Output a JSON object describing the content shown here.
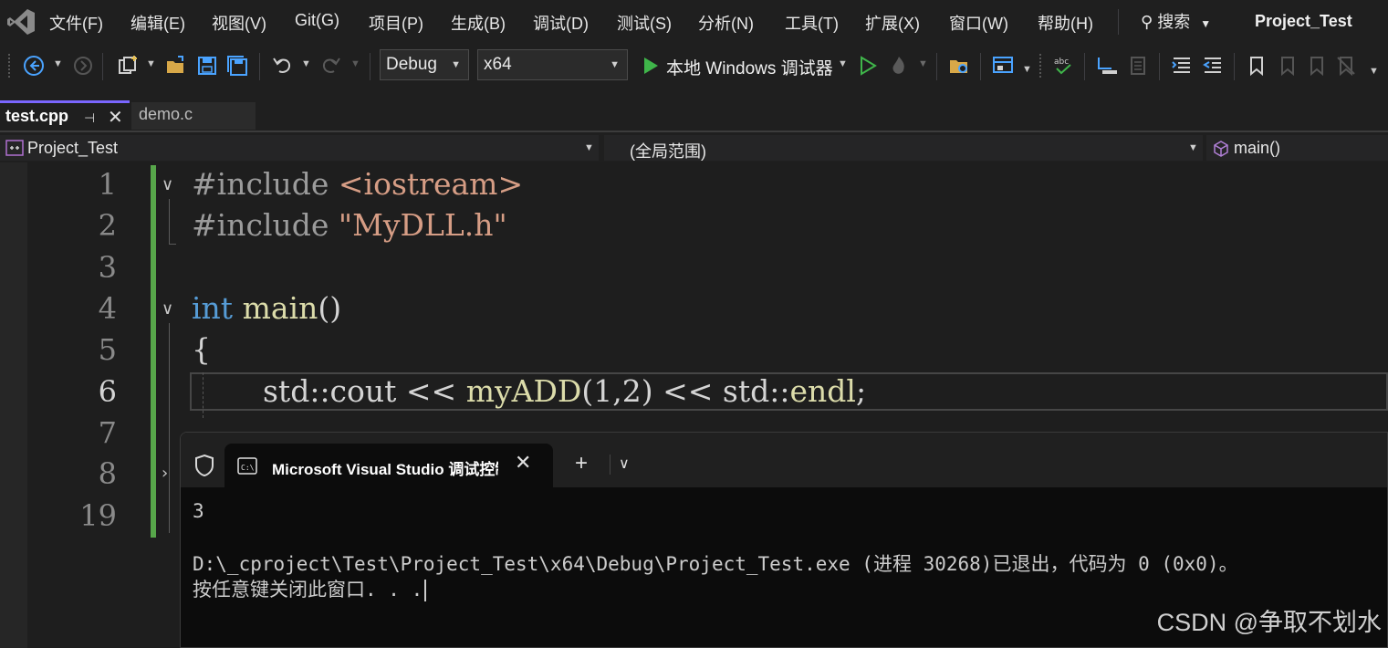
{
  "menubar": {
    "items": [
      "文件(F)",
      "编辑(E)",
      "视图(V)",
      "Git(G)",
      "项目(P)",
      "生成(B)",
      "调试(D)",
      "测试(S)",
      "分析(N)",
      "工具(T)",
      "扩展(X)",
      "窗口(W)",
      "帮助(H)"
    ],
    "search_label": "搜索",
    "project_title": "Project_Test"
  },
  "toolbar": {
    "config": "Debug",
    "platform": "x64",
    "run_label": "本地 Windows 调试器"
  },
  "tabs": {
    "active": "test.cpp",
    "other": "demo.c"
  },
  "navbar": {
    "project": "Project_Test",
    "scope": "(全局范围)",
    "member": "main()"
  },
  "editor": {
    "line_numbers": [
      "1",
      "2",
      "3",
      "4",
      "5",
      "6",
      "7",
      "8",
      "19"
    ],
    "current_line": "6",
    "lines": {
      "l1_directive": "#include",
      "l1_header": "<iostream>",
      "l2_directive": "#include",
      "l2_header": "\"MyDLL.h\"",
      "l4_type": "int",
      "l4_func": "main",
      "l4_parens": "()",
      "l5_brace": "{",
      "l6_a": "std::cout << ",
      "l6_func": "myADD",
      "l6_b": "(1,2) << std::",
      "l6_endl": "endl",
      "l6_c": ";"
    }
  },
  "console": {
    "tab_title": "Microsoft Visual Studio 调试控制台",
    "output_value": "3",
    "exit_message": "D:\\_cproject\\Test\\Project_Test\\x64\\Debug\\Project_Test.exe (进程 30268)已退出，代码为 0 (0x0)。",
    "prompt": "按任意键关闭此窗口. . ."
  },
  "watermark": "CSDN @争取不划水"
}
